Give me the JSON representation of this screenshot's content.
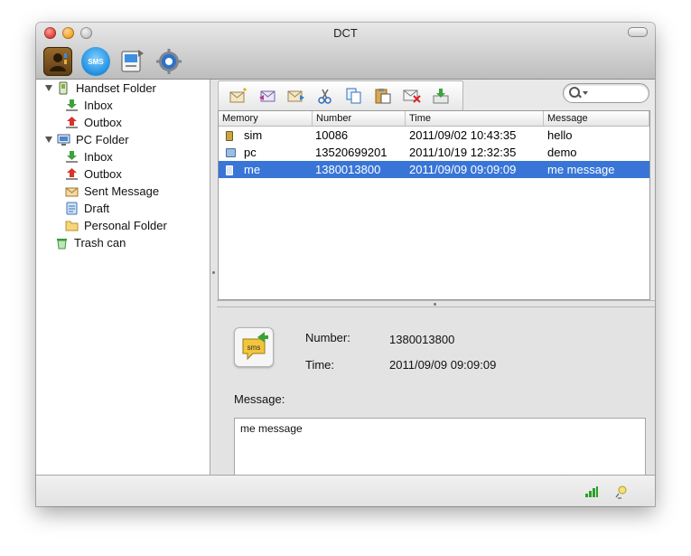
{
  "window": {
    "title": "DCT"
  },
  "toolbar": {
    "buttons": [
      {
        "name": "contacts",
        "icon": "contacts-book-icon"
      },
      {
        "name": "sms",
        "icon": "sms-bubble-icon",
        "label": "SMS"
      },
      {
        "name": "backup",
        "icon": "backup-icon"
      },
      {
        "name": "settings",
        "icon": "gear-icon"
      }
    ]
  },
  "sidebar": {
    "handset_folder": {
      "label": "Handset Folder",
      "inbox": "Inbox",
      "outbox": "Outbox"
    },
    "pc_folder": {
      "label": "PC Folder",
      "inbox": "Inbox",
      "outbox": "Outbox",
      "sent": "Sent Message",
      "draft": "Draft",
      "personal": "Personal Folder"
    },
    "trash": "Trash can"
  },
  "message_toolbar": {
    "icons": [
      "new-message-icon",
      "reply-icon",
      "forward-icon",
      "cut-icon",
      "copy-icon",
      "paste-icon",
      "delete-icon",
      "export-icon"
    ]
  },
  "search": {
    "placeholder": ""
  },
  "table": {
    "columns": [
      "Memory",
      "Number",
      "Time",
      "Message"
    ],
    "rows": [
      {
        "memory": "sim",
        "number": "10086",
        "time": "2011/09/02 10:43:35",
        "message": "hello",
        "selected": false
      },
      {
        "memory": "pc",
        "number": "13520699201",
        "time": "2011/10/19 12:32:35",
        "message": "demo",
        "selected": false
      },
      {
        "memory": "me",
        "number": "1380013800",
        "time": "2011/09/09 09:09:09",
        "message": "me message",
        "selected": true
      }
    ]
  },
  "detail": {
    "badge": "sms",
    "number_label": "Number:",
    "number_value": "1380013800",
    "time_label": "Time:",
    "time_value": "2011/09/09 09:09:09",
    "message_label": "Message:",
    "message_body": "me message"
  },
  "status": {
    "signal_icon": "signal-strength-icon",
    "connection_icon": "connection-bulb-icon"
  },
  "colors": {
    "selection": "#3875d7",
    "signal": "#2aa12a"
  }
}
